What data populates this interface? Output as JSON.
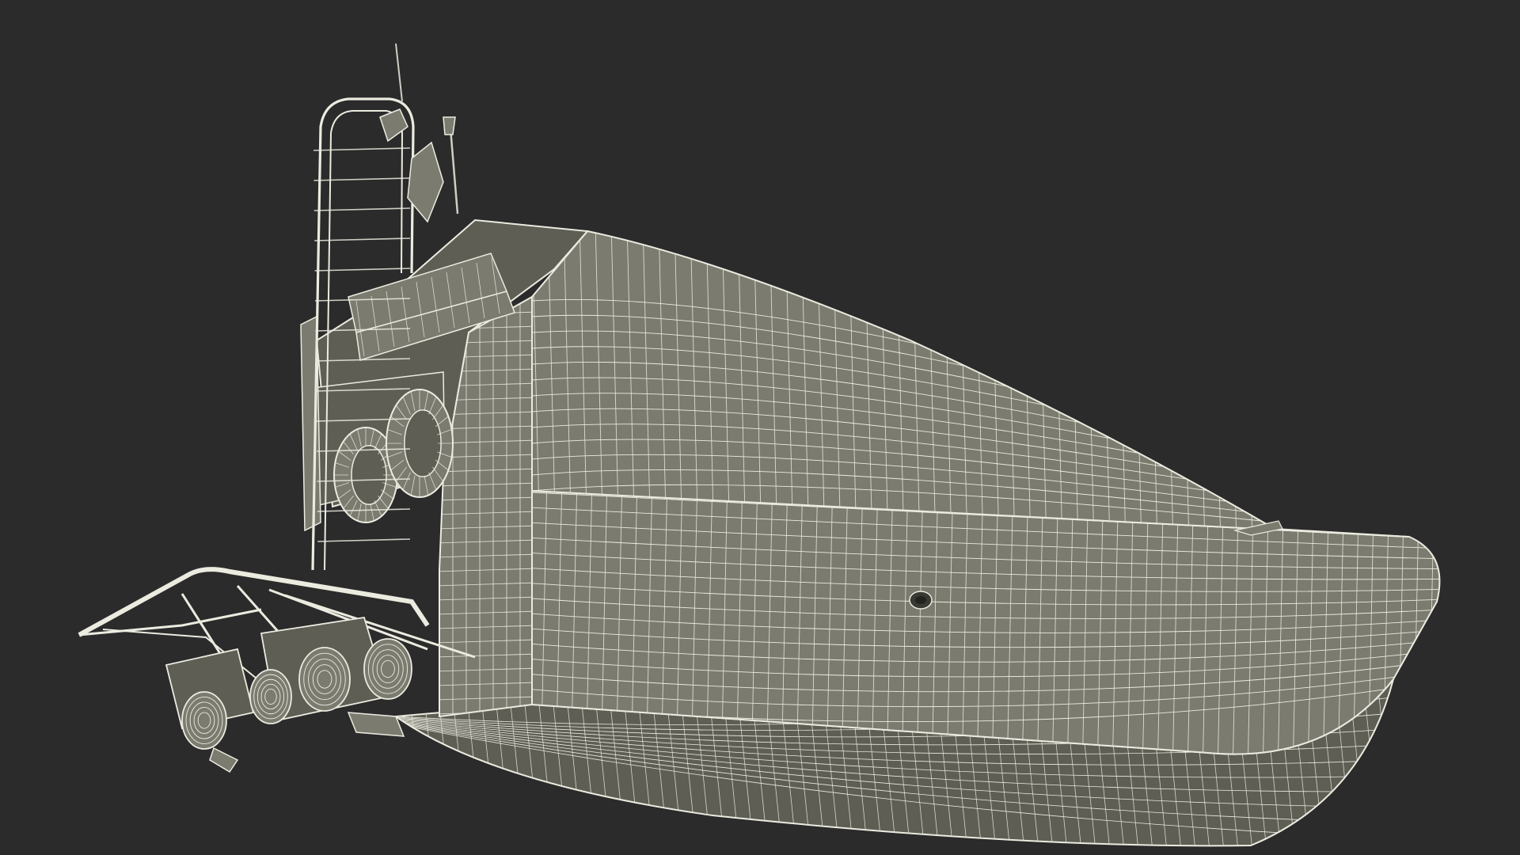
{
  "scene": {
    "background_color": "#2b2b2b",
    "surface_color": "#7b7b70",
    "surface_dark_color": "#5e5e55",
    "wire_color": "#ecebe0"
  }
}
